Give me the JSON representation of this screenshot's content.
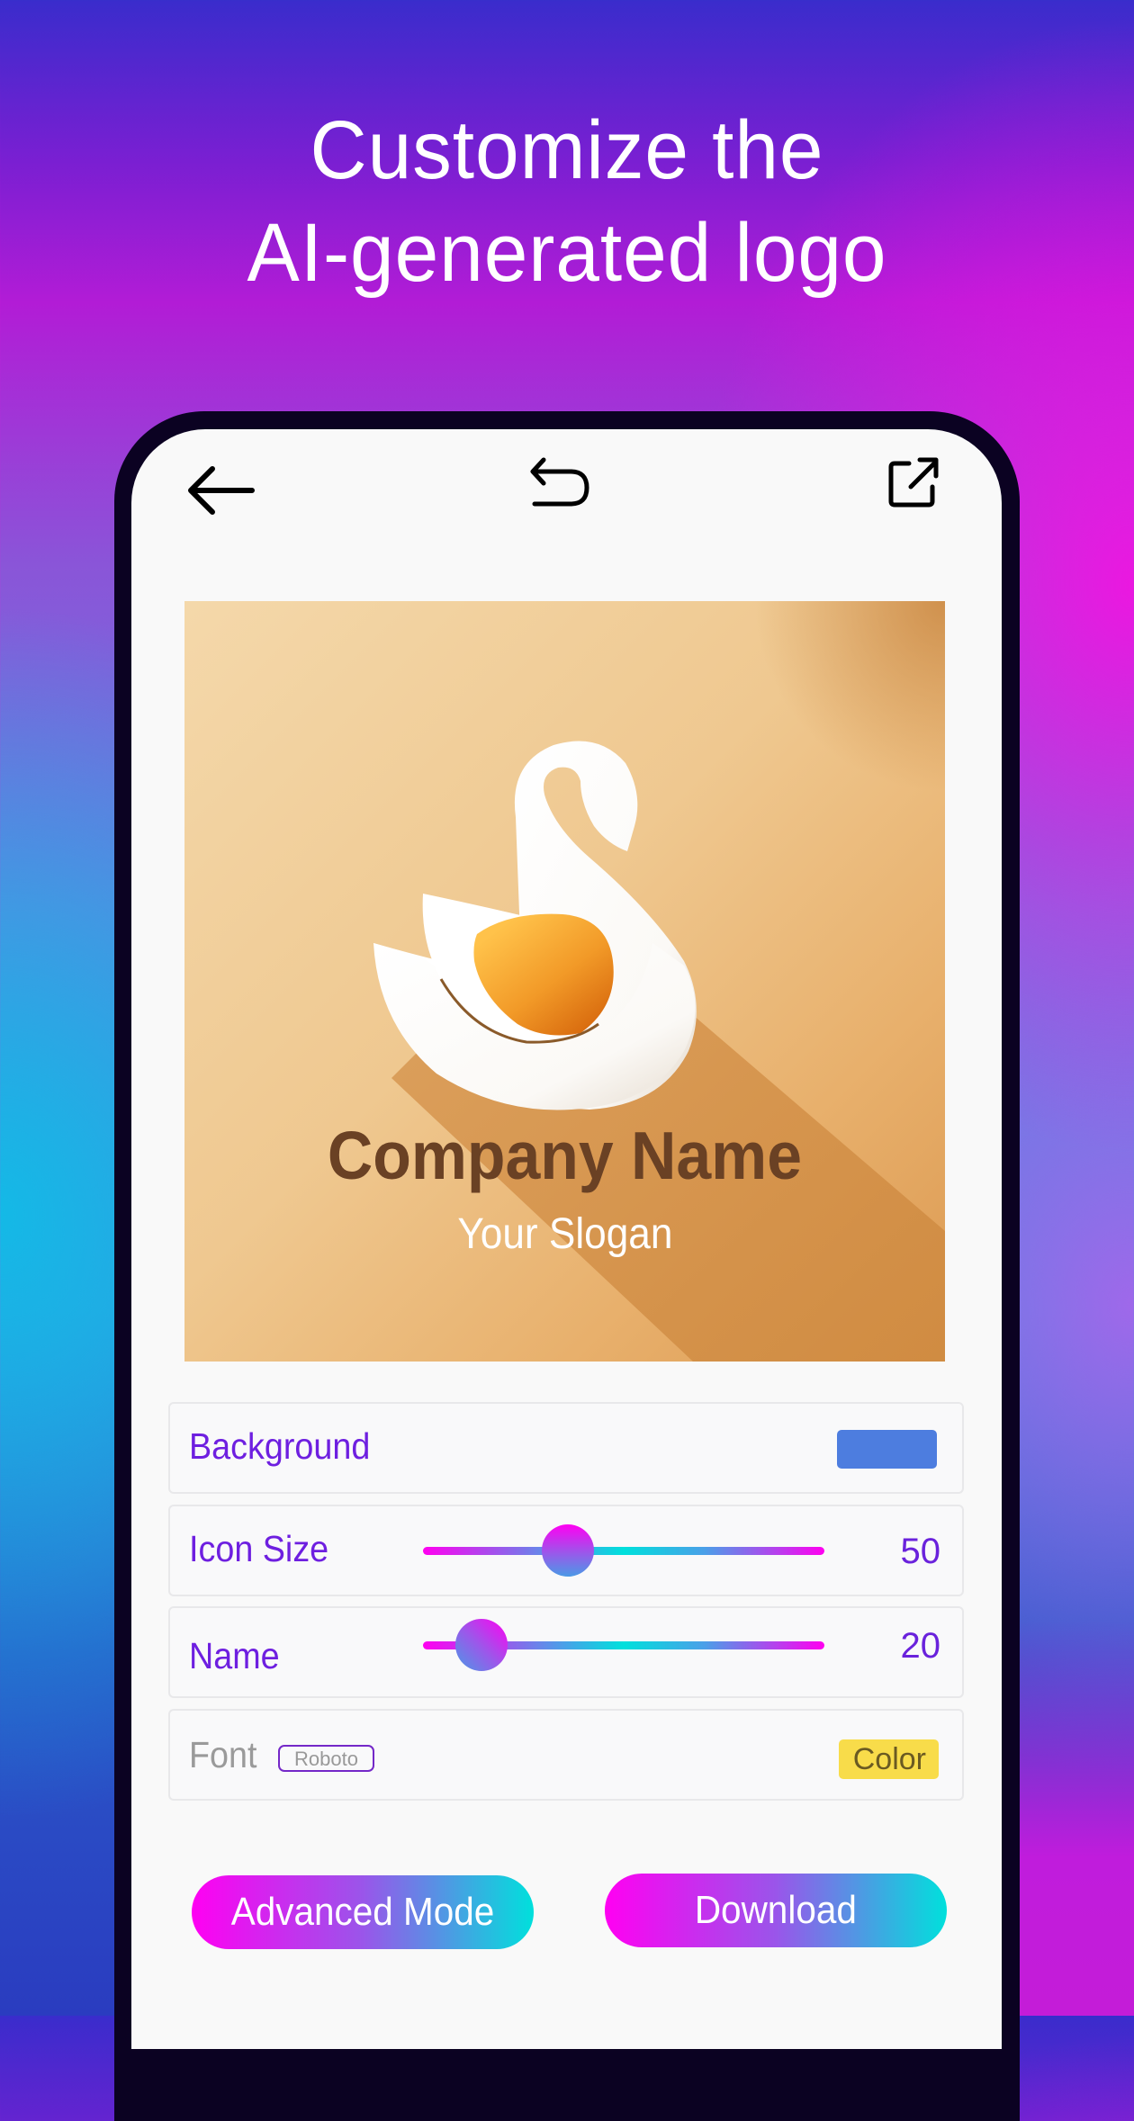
{
  "headline": {
    "line1": "Customize the",
    "line2": "AI-generated logo"
  },
  "toolbar": {
    "back_icon": "arrow-left-icon",
    "undo_icon": "undo-icon",
    "share_icon": "external-share-icon"
  },
  "logo": {
    "company_name": "Company Name",
    "slogan": "Your Slogan",
    "icon": "swan-icon"
  },
  "controls": {
    "background": {
      "label": "Background",
      "color": "#4d7ddf"
    },
    "icon_size": {
      "label": "Icon Size",
      "value": "50",
      "fraction": 0.36
    },
    "name": {
      "label": "Name",
      "value": "20",
      "fraction": 0.145
    },
    "font": {
      "label": "Font",
      "selected": "Roboto",
      "color_button": "Color",
      "color": "#f8dc4a"
    }
  },
  "buttons": {
    "advanced": "Advanced Mode",
    "download": "Download"
  },
  "colors": {
    "accent_purple": "#6e1fe0",
    "gradient_start": "#ff00f2",
    "gradient_end": "#00e0dc"
  }
}
